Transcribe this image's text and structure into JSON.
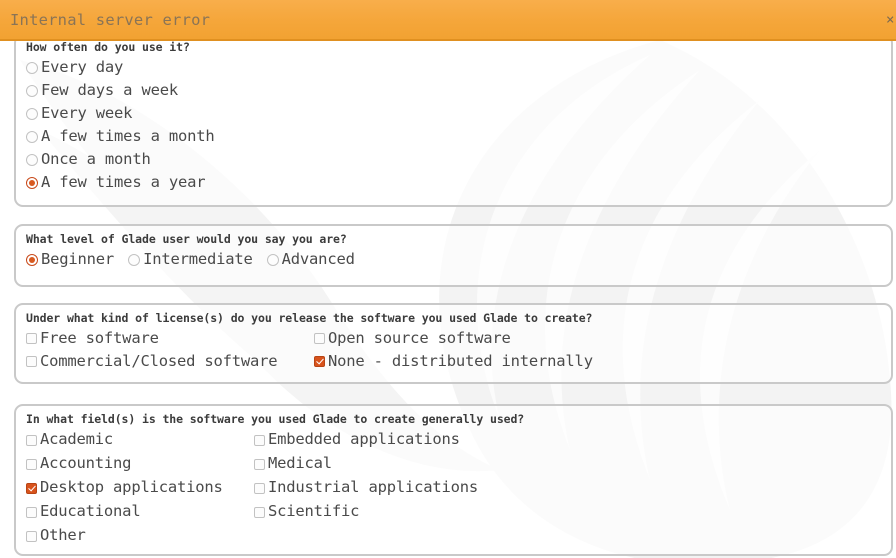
{
  "banner": {
    "message": "Internal server error",
    "close_label": "×",
    "background_color": "#f5a63a",
    "text_color": "#8a7456"
  },
  "theme": {
    "accent_color": "#d8531c",
    "group_border_color": "#c9c9c9",
    "text_color": "#4a4a4a"
  },
  "groups": [
    {
      "id": "frequency",
      "title": "How often do you use it?",
      "type": "radio",
      "options": [
        {
          "label": "Every day",
          "selected": false
        },
        {
          "label": "Few days a week",
          "selected": false
        },
        {
          "label": "Every week",
          "selected": false
        },
        {
          "label": "A few times a month",
          "selected": false
        },
        {
          "label": "Once a month",
          "selected": false
        },
        {
          "label": "A few times a year",
          "selected": true
        }
      ]
    },
    {
      "id": "level",
      "title": "What level of Glade user would you say you are?",
      "type": "radio",
      "options": [
        {
          "label": "Beginner",
          "selected": true
        },
        {
          "label": "Intermediate",
          "selected": false
        },
        {
          "label": "Advanced",
          "selected": false
        }
      ]
    },
    {
      "id": "license",
      "title": "Under what kind of license(s) do you release the software you used Glade to create?",
      "type": "checkbox",
      "options": [
        {
          "label": "Free software",
          "checked": false
        },
        {
          "label": "Open source software",
          "checked": false
        },
        {
          "label": "Commercial/Closed software",
          "checked": false
        },
        {
          "label": "None - distributed internally",
          "checked": true
        }
      ]
    },
    {
      "id": "fields",
      "title": "In what field(s) is the software you used Glade to create generally used?",
      "type": "checkbox",
      "options": [
        {
          "label": "Academic",
          "checked": false
        },
        {
          "label": "Embedded applications",
          "checked": false
        },
        {
          "label": "Accounting",
          "checked": false
        },
        {
          "label": "Medical",
          "checked": false
        },
        {
          "label": "Desktop applications",
          "checked": true
        },
        {
          "label": "Industrial applications",
          "checked": false
        },
        {
          "label": "Educational",
          "checked": false
        },
        {
          "label": "Scientific",
          "checked": false
        },
        {
          "label": "Other",
          "checked": false
        }
      ]
    }
  ]
}
